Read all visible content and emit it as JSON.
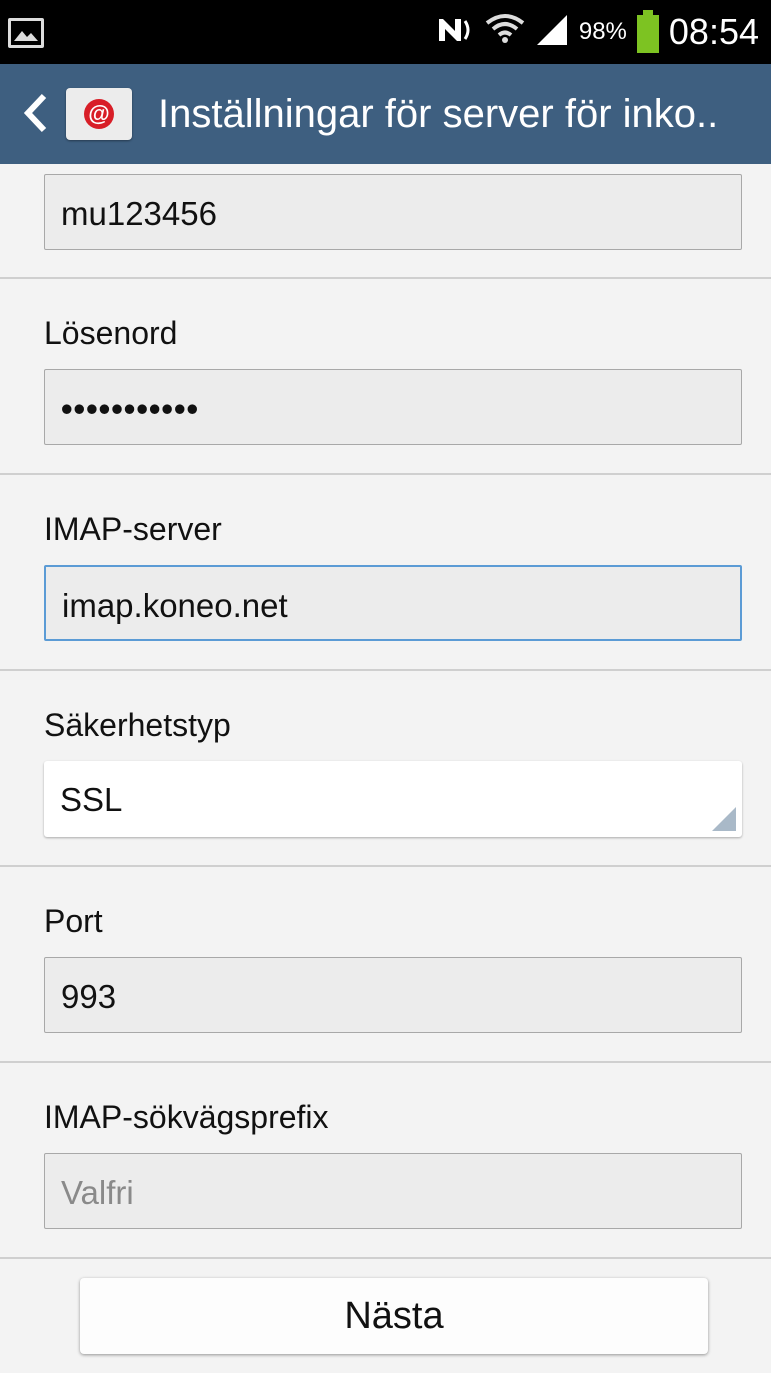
{
  "status_bar": {
    "battery_percent": "98%",
    "time": "08:54"
  },
  "action_bar": {
    "title": "Inställningar för server för inko.."
  },
  "form": {
    "username_value": "mu123456",
    "password_label": "Lösenord",
    "password_value": "•••••••••••",
    "imap_server_label": "IMAP-server",
    "imap_server_value": "imap.koneo.net",
    "security_label": "Säkerhetstyp",
    "security_value": "SSL",
    "port_label": "Port",
    "port_value": "993",
    "prefix_label": "IMAP-sökvägsprefix",
    "prefix_placeholder": "Valfri"
  },
  "footer": {
    "next_label": "Nästa"
  },
  "colors": {
    "action_bar": "#3e5f80",
    "battery": "#7dc322",
    "focus_border": "#5b9bd5",
    "app_icon_accent": "#d81e27"
  }
}
